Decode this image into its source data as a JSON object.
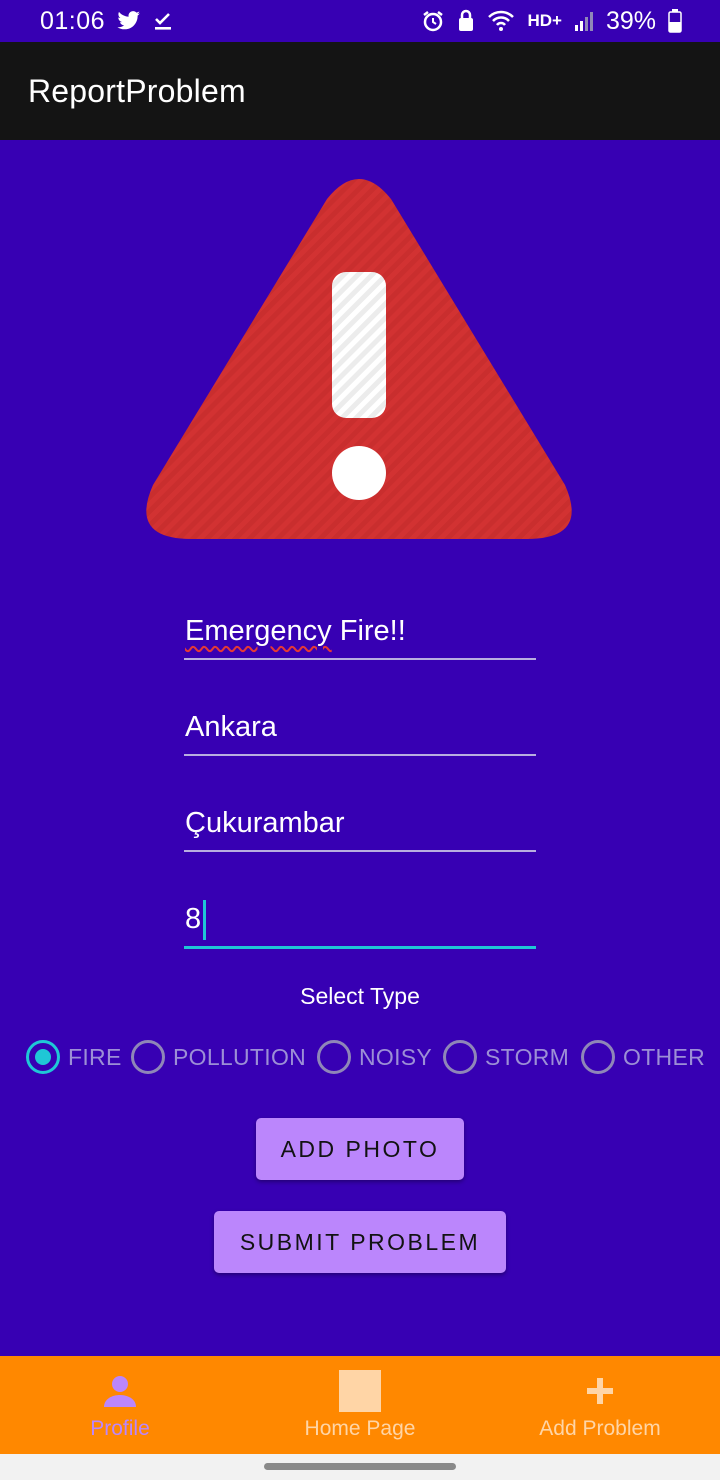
{
  "status_bar": {
    "time": "01:06",
    "battery": "39%",
    "network": "HD+",
    "left_icons": [
      "twitter-icon",
      "check-icon"
    ],
    "right_icons": [
      "alarm-icon",
      "lock-icon",
      "wifi-icon",
      "signal-icon",
      "battery-icon"
    ]
  },
  "app_bar": {
    "title": "ReportProblem"
  },
  "warning_image": {
    "icon": "warning-triangle-icon",
    "color": "#d23232"
  },
  "form": {
    "fields": [
      {
        "value_word1": "Emergency",
        "value_rest": " Fire!!"
      },
      {
        "value": "Ankara"
      },
      {
        "value": "Çukurambar"
      },
      {
        "value": "8"
      }
    ],
    "select_type_label": "Select Type",
    "types": [
      "FIRE",
      "POLLUTION",
      "NOISY",
      "STORM",
      "OTHER"
    ],
    "selected_type": "FIRE"
  },
  "buttons": {
    "add_photo": "ADD PHOTO",
    "submit": "SUBMIT PROBLEM"
  },
  "bottom_nav": {
    "items": [
      {
        "label": "Profile",
        "icon": "person-icon",
        "active": true
      },
      {
        "label": "Home Page",
        "icon": "home-square-icon",
        "active": false
      },
      {
        "label": "Add Problem",
        "icon": "plus-icon",
        "active": false
      }
    ]
  },
  "colors": {
    "background": "#3700b3",
    "app_bar": "#141414",
    "accent": "#1fc7d6",
    "button": "#bb86fc",
    "bottom_nav": "#ff8800"
  }
}
